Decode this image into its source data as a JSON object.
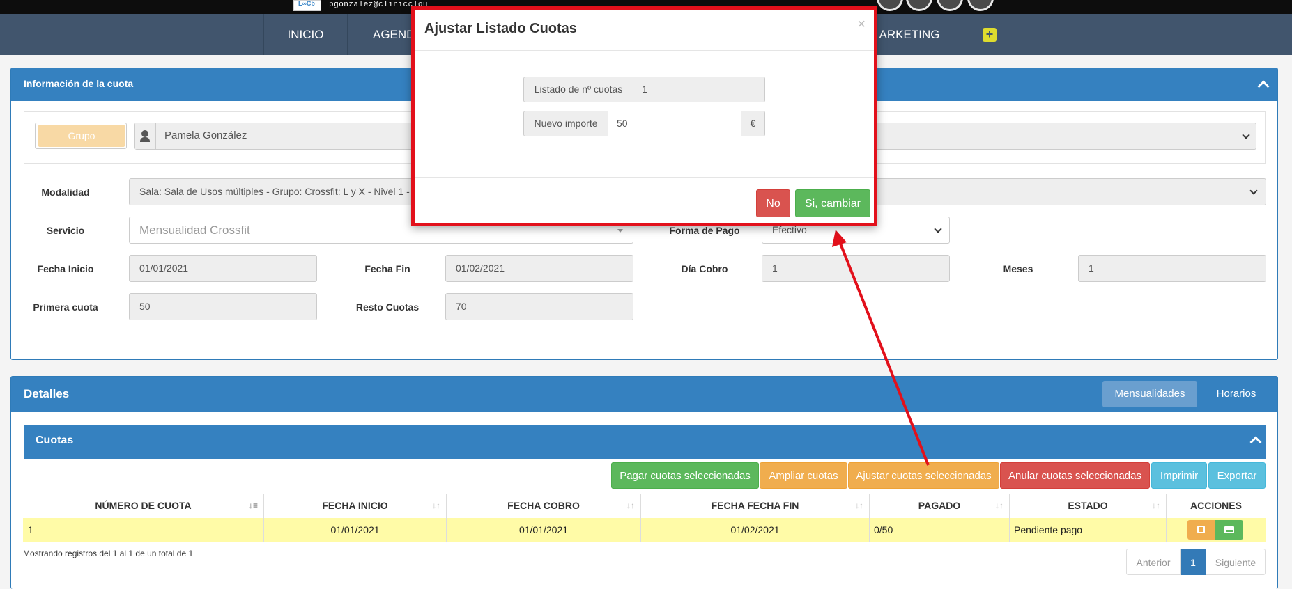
{
  "topbar": {
    "logo_text": "L∞Cb",
    "email": "pgonzalez@clinicclou"
  },
  "nav": {
    "items": [
      "INICIO",
      "AGENDA",
      "ARKETING"
    ],
    "plus_label": "+"
  },
  "info_panel": {
    "title": "Información de la cuota",
    "group_toggle": "Grupo",
    "client_name": "Pamela González",
    "modalidad_label": "Modalidad",
    "modalidad_value": "Sala: Sala de Usos múltiples - Grupo: Crossfit: L y X - Nivel 1 - C",
    "servicio_label": "Servicio",
    "servicio_placeholder": "Mensualidad Crossfit",
    "forma_pago_label": "Forma de Pago",
    "forma_pago_value": "Efectivo",
    "fecha_inicio_label": "Fecha Inicio",
    "fecha_inicio_value": "01/01/2021",
    "fecha_fin_label": "Fecha Fin",
    "fecha_fin_value": "01/02/2021",
    "dia_cobro_label": "Día Cobro",
    "dia_cobro_value": "1",
    "meses_label": "Meses",
    "meses_value": "1",
    "primera_cuota_label": "Primera cuota",
    "primera_cuota_value": "50",
    "resto_cuotas_label": "Resto Cuotas",
    "resto_cuotas_value": "70"
  },
  "detalles_panel": {
    "title": "Detalles",
    "tabs": [
      "Mensualidades",
      "Horarios"
    ],
    "cuotas_title": "Cuotas",
    "actions": {
      "pagar": "Pagar cuotas seleccionadas",
      "ampliar": "Ampliar cuotas",
      "ajustar": "Ajustar cuotas seleccionadas",
      "anular": "Anular cuotas seleccionadas",
      "imprimir": "Imprimir",
      "exportar": "Exportar"
    },
    "table": {
      "headers": [
        "NÚMERO DE CUOTA",
        "FECHA INICIO",
        "FECHA COBRO",
        "FECHA FECHA FIN",
        "PAGADO",
        "ESTADO",
        "ACCIONES"
      ],
      "rows": [
        {
          "numero": "1",
          "fecha_inicio": "01/01/2021",
          "fecha_cobro": "01/01/2021",
          "fecha_fin": "01/02/2021",
          "pagado": "0/50",
          "estado": "Pendiente pago"
        }
      ]
    },
    "info_text": "Mostrando registros del 1 al 1 de un total de 1",
    "pagination": {
      "prev": "Anterior",
      "current": "1",
      "next": "Siguiente"
    }
  },
  "modal": {
    "title": "Ajustar Listado Cuotas",
    "close": "×",
    "listado_label": "Listado de nº cuotas",
    "listado_value": "1",
    "importe_label": "Nuevo importe",
    "importe_value": "50",
    "currency": "€",
    "no_label": "No",
    "yes_label": "Si, cambiar"
  },
  "colors": {
    "nav_bg": "#41556d",
    "panel_blue": "#3581c0",
    "highlight_red": "#e2101b",
    "row_yellow": "#fffba7"
  }
}
